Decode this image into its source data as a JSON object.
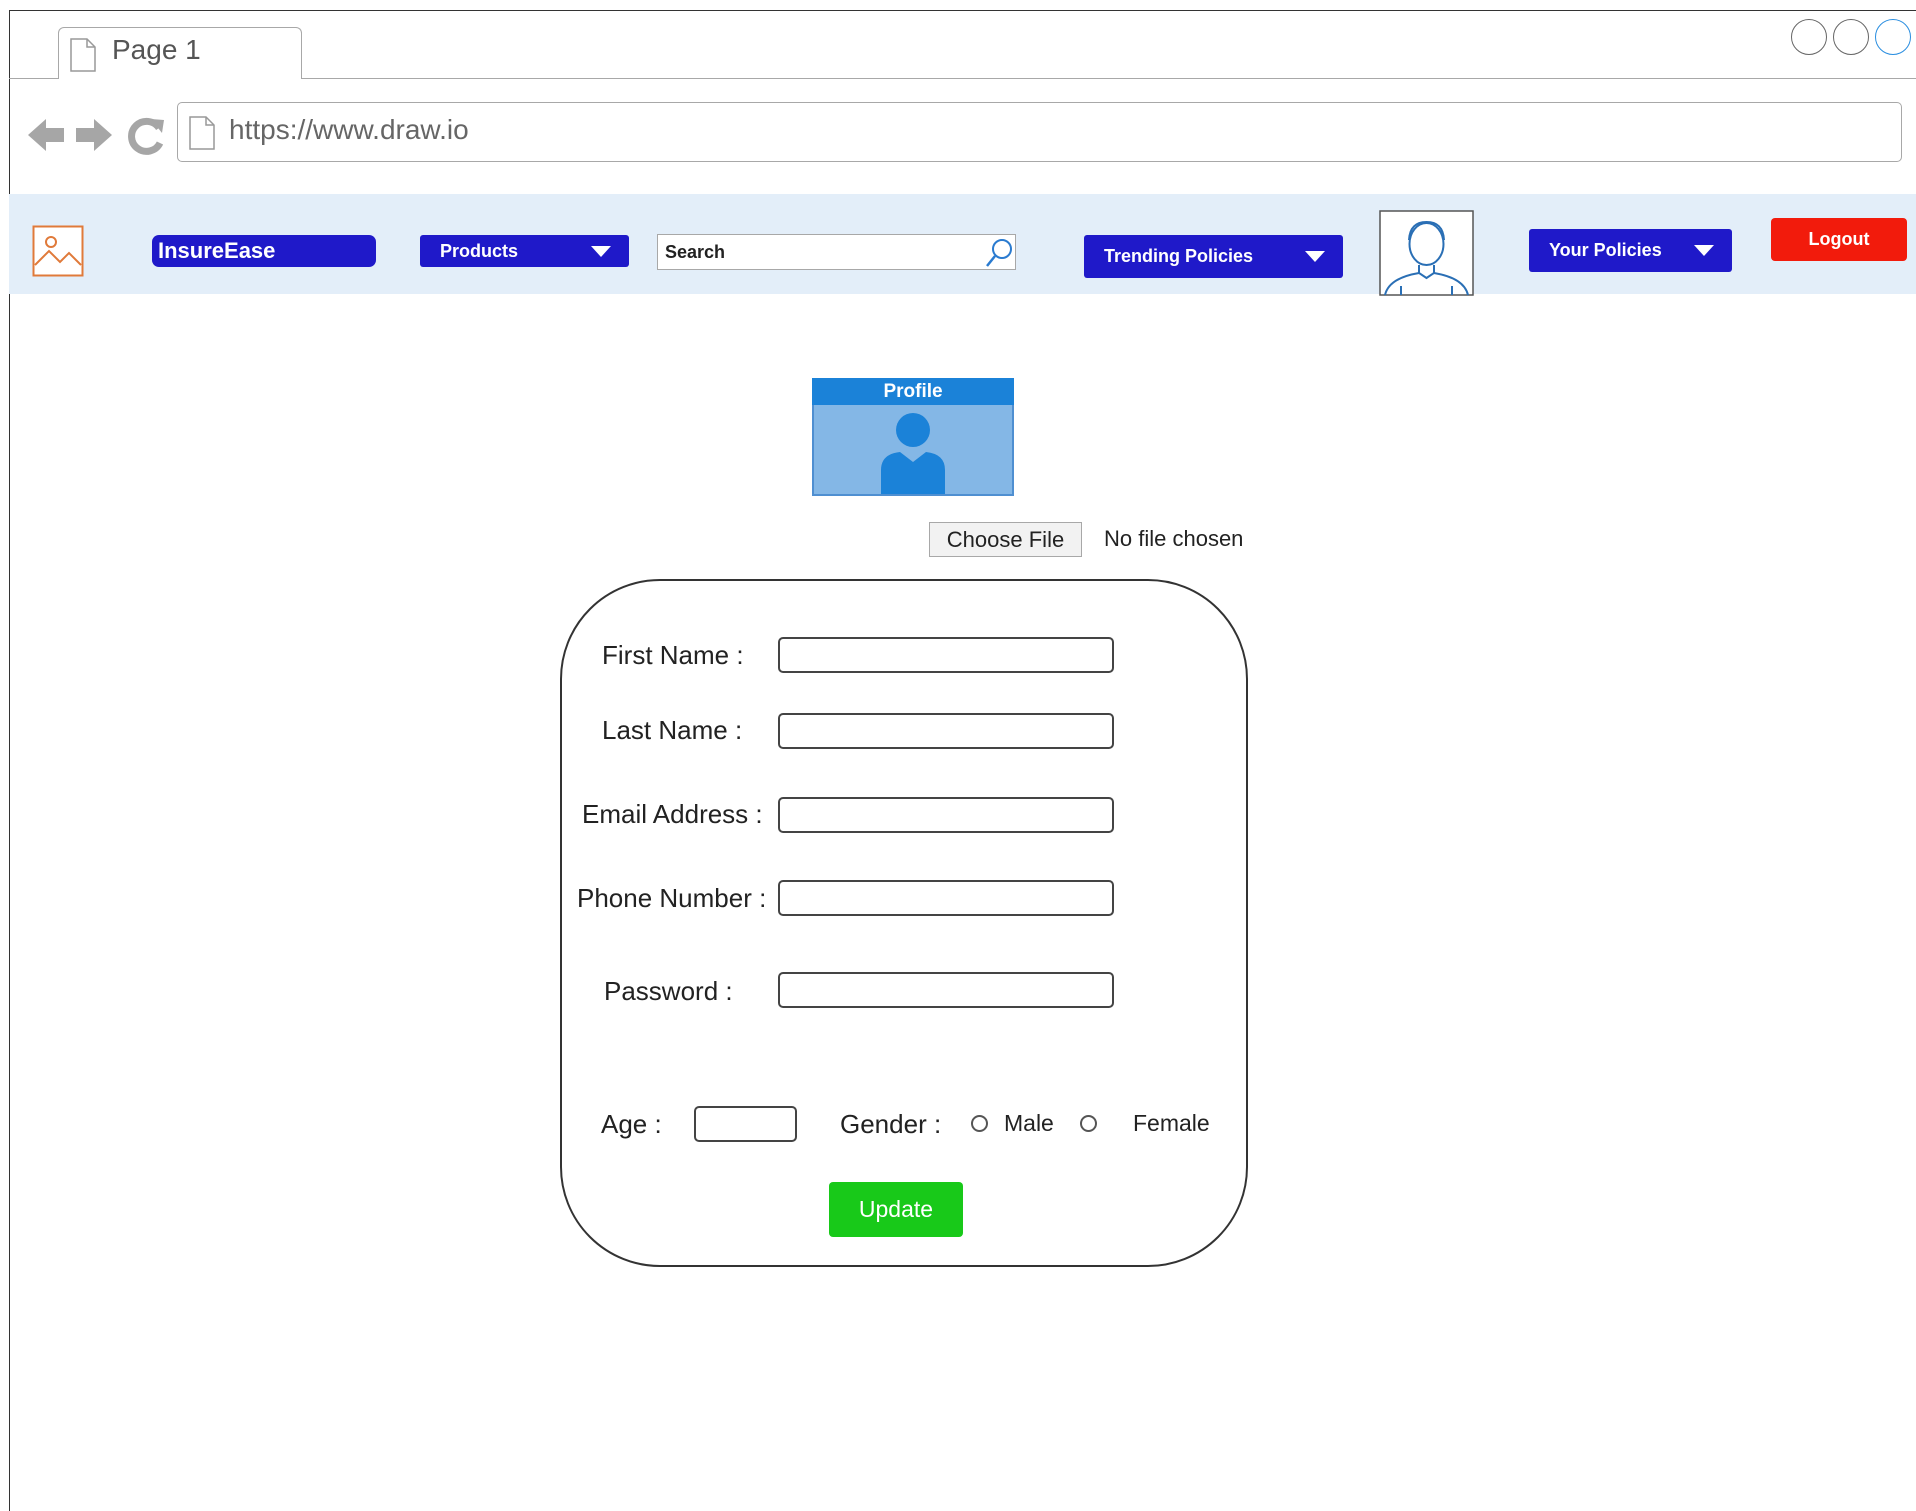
{
  "browser": {
    "tab_title": "Page 1",
    "url": "https://www.draw.io"
  },
  "navbar": {
    "brand": "InsureEase",
    "products_label": "Products",
    "search_placeholder": "Search",
    "trending_label": "Trending Policies",
    "your_policies_label": "Your Policies",
    "logout_label": "Logout"
  },
  "profile": {
    "card_title": "Profile",
    "choose_file_label": "Choose File",
    "file_status": "No file chosen"
  },
  "form": {
    "first_name_label": "First Name :",
    "last_name_label": "Last Name :",
    "email_label": "Email Address :",
    "phone_label": "Phone Number :",
    "password_label": "Password  :",
    "age_label": "Age :",
    "gender_label": "Gender :",
    "gender_options": [
      "Male",
      "Female"
    ],
    "update_label": "Update"
  },
  "colors": {
    "nav_button": "#1f19c9",
    "logout": "#f21b0c",
    "update": "#18c919",
    "navbar_bg": "#e3eef9",
    "profile_header": "#1b82d8"
  }
}
